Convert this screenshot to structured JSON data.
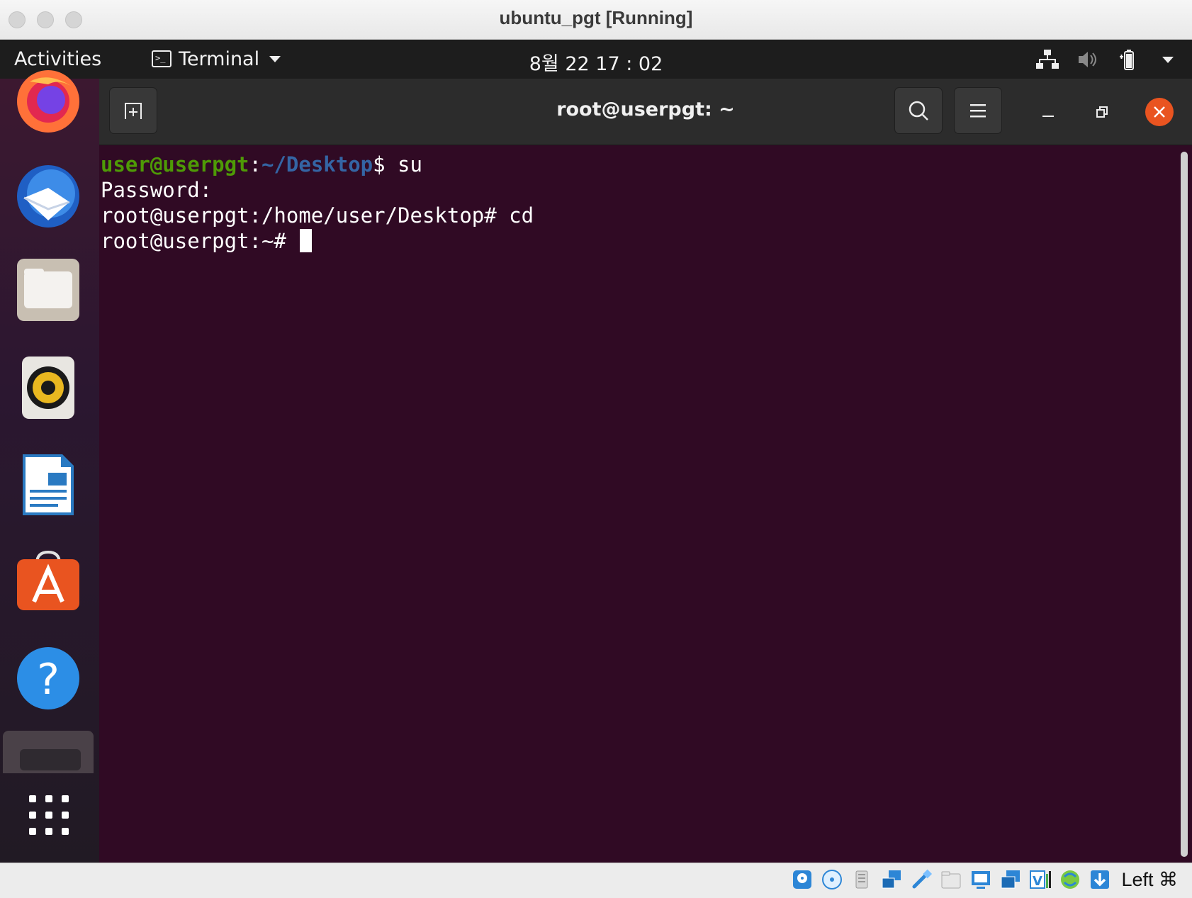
{
  "host_window": {
    "title": "ubuntu_pgt [Running]"
  },
  "topbar": {
    "activities": "Activities",
    "app_menu_label": "Terminal",
    "clock": "8월 22  17 : 02"
  },
  "dock": {
    "items": [
      "firefox",
      "thunderbird",
      "files",
      "rhythmbox",
      "libreoffice-writer",
      "ubuntu-software",
      "help",
      "terminal",
      "show-applications"
    ]
  },
  "terminal": {
    "title": "root@userpgt: ~",
    "lines": [
      {
        "user_host": "user@userpgt",
        "sep": ":",
        "path": "~/Desktop",
        "prompt_end": "$ ",
        "command": "su"
      },
      {
        "text": "Password:"
      },
      {
        "text": "root@userpgt:/home/user/Desktop# cd"
      },
      {
        "text": "root@userpgt:~# "
      }
    ],
    "colors": {
      "background": "#300a24",
      "user": "#4e9a06",
      "path": "#3465a4"
    }
  },
  "vbox_status": {
    "icons": [
      "hard-disk-icon",
      "optical-disk-icon",
      "audio-icon",
      "network-icon",
      "usb-icon",
      "shared-folders-icon",
      "display-icon",
      "recording-icon",
      "virtualization-icon",
      "guest-additions-icon",
      "mouse-integration-icon"
    ],
    "host_key": "Left ⌘"
  }
}
